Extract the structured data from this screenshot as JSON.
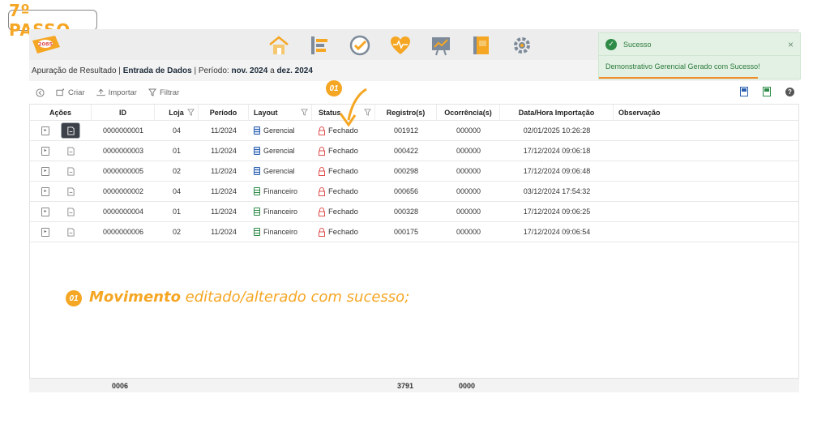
{
  "step": {
    "label": "7º PASSO"
  },
  "app": {
    "logo_text": "2085"
  },
  "nav_icons": [
    "home-icon",
    "timeline-icon",
    "check-circle-icon",
    "heart-pulse-icon",
    "chart-board-icon",
    "notebook-icon",
    "gear-network-icon"
  ],
  "breadcrumb": {
    "part1": "Apuração de Resultado",
    "sep1": " | ",
    "part2": "Entrada de Dados",
    "sep2": " | Período: ",
    "from": "nov. 2024",
    "mid": " a ",
    "to": "dez. 2024"
  },
  "toast": {
    "title": "Sucesso",
    "message": "Demonstrativo Gerencial Gerado com Sucesso!",
    "close": "×"
  },
  "toolbar": {
    "criar": "Criar",
    "importar": "Importar",
    "filtrar": "Filtrar",
    "help": "?"
  },
  "table": {
    "headers": {
      "acoes": "Ações",
      "id": "ID",
      "loja": "Loja",
      "periodo": "Período",
      "layout": "Layout",
      "status": "Status",
      "registros": "Registro(s)",
      "ocorrencias": "Ocorrência(s)",
      "data": "Data/Hora Importação",
      "obs": "Observação"
    },
    "rows": [
      {
        "id": "0000000001",
        "loja": "04",
        "periodo": "11/2024",
        "layout": "Gerencial",
        "status": "Fechado",
        "registros": "001912",
        "ocorrencias": "000000",
        "data": "02/01/2025 10:26:28"
      },
      {
        "id": "0000000003",
        "loja": "01",
        "periodo": "11/2024",
        "layout": "Gerencial",
        "status": "Fechado",
        "registros": "000422",
        "ocorrencias": "000000",
        "data": "17/12/2024 09:06:18"
      },
      {
        "id": "0000000005",
        "loja": "02",
        "periodo": "11/2024",
        "layout": "Gerencial",
        "status": "Fechado",
        "registros": "000298",
        "ocorrencias": "000000",
        "data": "17/12/2024 09:06:48"
      },
      {
        "id": "0000000002",
        "loja": "04",
        "periodo": "11/2024",
        "layout": "Financeiro",
        "status": "Fechado",
        "registros": "000656",
        "ocorrencias": "000000",
        "data": "03/12/2024 17:54:32"
      },
      {
        "id": "0000000004",
        "loja": "01",
        "periodo": "11/2024",
        "layout": "Financeiro",
        "status": "Fechado",
        "registros": "000328",
        "ocorrencias": "000000",
        "data": "17/12/2024 09:06:25"
      },
      {
        "id": "0000000006",
        "loja": "02",
        "periodo": "11/2024",
        "layout": "Financeiro",
        "status": "Fechado",
        "registros": "000175",
        "ocorrencias": "000000",
        "data": "17/12/2024 09:06:54"
      }
    ],
    "footer": {
      "count": "0006",
      "registros_total": "3791",
      "ocorrencias_total": "0000"
    }
  },
  "annotation": {
    "number": "01",
    "bold": "Movimento",
    "text": " editado/alterado com sucesso;"
  },
  "colors": {
    "accent": "#f5a623",
    "success": "#2e8b47",
    "lock": "#e05050"
  }
}
